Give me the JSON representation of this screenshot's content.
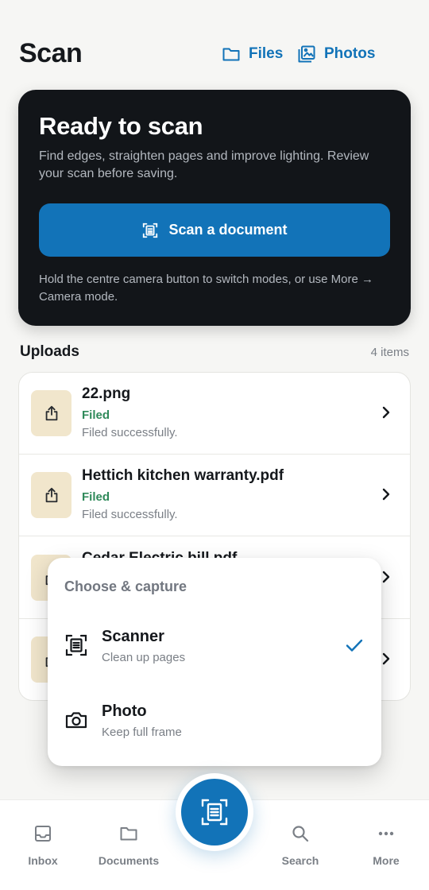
{
  "header": {
    "title": "Scan",
    "files_label": "Files",
    "photos_label": "Photos"
  },
  "hero": {
    "title": "Ready to scan",
    "description": "Find edges, straighten pages and improve lighting. Review your scan before saving.",
    "button_label": "Scan a document",
    "hint": "Hold the centre camera button to switch modes, or use More → Camera mode."
  },
  "uploads": {
    "title": "Uploads",
    "count": "4 items",
    "items": [
      {
        "name": "22.png",
        "status": "Filed",
        "detail": "Filed successfully."
      },
      {
        "name": "Hettich kitchen warranty.pdf",
        "status": "Filed",
        "detail": "Filed successfully."
      },
      {
        "name": "Cedar Electric bill.pdf",
        "status": "",
        "detail": ""
      },
      {
        "name": "",
        "status": "",
        "detail": ""
      }
    ]
  },
  "capture_menu": {
    "title": "Choose & capture",
    "options": [
      {
        "label": "Scanner",
        "description": "Clean up pages",
        "selected": true
      },
      {
        "label": "Photo",
        "description": "Keep full frame",
        "selected": false
      }
    ]
  },
  "nav": {
    "items": [
      {
        "label": "Inbox",
        "icon": "inbox-icon"
      },
      {
        "label": "Documents",
        "icon": "folder-icon"
      },
      {
        "label": "Search",
        "icon": "search-icon"
      },
      {
        "label": "More",
        "icon": "more-icon"
      }
    ],
    "center_icon": "document-scan-icon"
  },
  "colors": {
    "accent": "#1273b8",
    "hero_background": "#121519",
    "status_green": "#2f8a5a",
    "upload_icon_bg": "#f1e6cc"
  }
}
